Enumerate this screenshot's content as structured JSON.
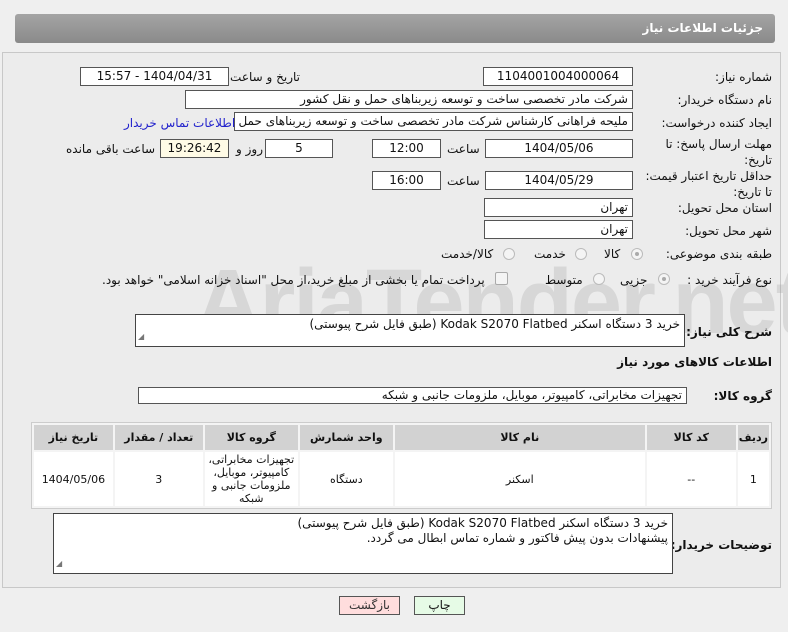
{
  "header": {
    "title": "جزئیات اطلاعات نیاز"
  },
  "form": {
    "need_number_label": "شماره نیاز:",
    "need_number": "1104001004000064",
    "announce_label": "تاریخ و ساعت اعلان عمومی:",
    "announce_value": "1404/04/31 - 15:57",
    "buyer_label": "نام دستگاه خریدار:",
    "buyer_value": "شرکت مادر تخصصی ساخت و توسعه زیربناهای حمل و نقل کشور",
    "creator_label": "ایجاد کننده درخواست:",
    "creator_value": "ملیحه فراهانی کارشناس شرکت مادر تخصصی ساخت و توسعه زیربناهای حمل",
    "contact_link": "اطلاعات تماس خریدار",
    "deadline_label": "مهلت ارسال پاسخ: تا تاریخ:",
    "deadline_date": "1404/05/06",
    "time_label": "ساعت",
    "deadline_time": "12:00",
    "days_value": "5",
    "days_label": "روز و",
    "remaining_time": "19:26:42",
    "remaining_label": "ساعت باقی مانده",
    "validity_label": "حداقل تاریخ اعتبار قیمت: تا تاریخ:",
    "validity_date": "1404/05/29",
    "validity_time": "16:00",
    "province_label": "استان محل تحویل:",
    "province_value": "تهران",
    "city_label": "شهر محل تحویل:",
    "city_value": "تهران",
    "category_label": "طبقه بندی موضوعی:",
    "cat_goods": "کالا",
    "cat_service": "خدمت",
    "cat_both": "کالا/خدمت",
    "process_label": "نوع فرآیند خرید :",
    "proc_partial": "جزیی",
    "proc_medium": "متوسط",
    "payment_note": "پرداخت تمام یا بخشی از مبلغ خرید،از محل \"اسناد خزانه اسلامی\" خواهد بود.",
    "desc_label": "شرح کلی نیاز:",
    "desc_value": "خرید 3 دستگاه اسکنر Kodak S2070 Flatbed (طبق فایل شرح پیوستی)",
    "goods_info_title": "اطلاعات کالاهای مورد نیاز",
    "goods_group_label": "گروه کالا:",
    "goods_group_value": "تجهیزات مخابراتی، کامپیوتر، موبایل، ملزومات جانبی و شبکه"
  },
  "table": {
    "headers": [
      "ردیف",
      "کد کالا",
      "نام کالا",
      "واحد شمارش",
      "گروه کالا",
      "تعداد / مقدار",
      "تاریخ نیاز"
    ],
    "rows": [
      [
        "1",
        "--",
        "اسکنر",
        "دستگاه",
        "تجهیزات مخابراتی، کامپیوتر، موبایل، ملزومات جانبی و شبکه",
        "3",
        "1404/05/06"
      ]
    ]
  },
  "notes": {
    "label": "توضیحات خریدار:",
    "line1": "خرید 3 دستگاه اسکنر Kodak S2070 Flatbed (طبق فایل شرح پیوستی)",
    "line2": "پیشنهادات بدون پیش فاکتور و شماره تماس ابطال می گردد."
  },
  "buttons": {
    "print": "چاپ",
    "back": "بازگشت"
  },
  "watermark": "AriaTender.net"
}
